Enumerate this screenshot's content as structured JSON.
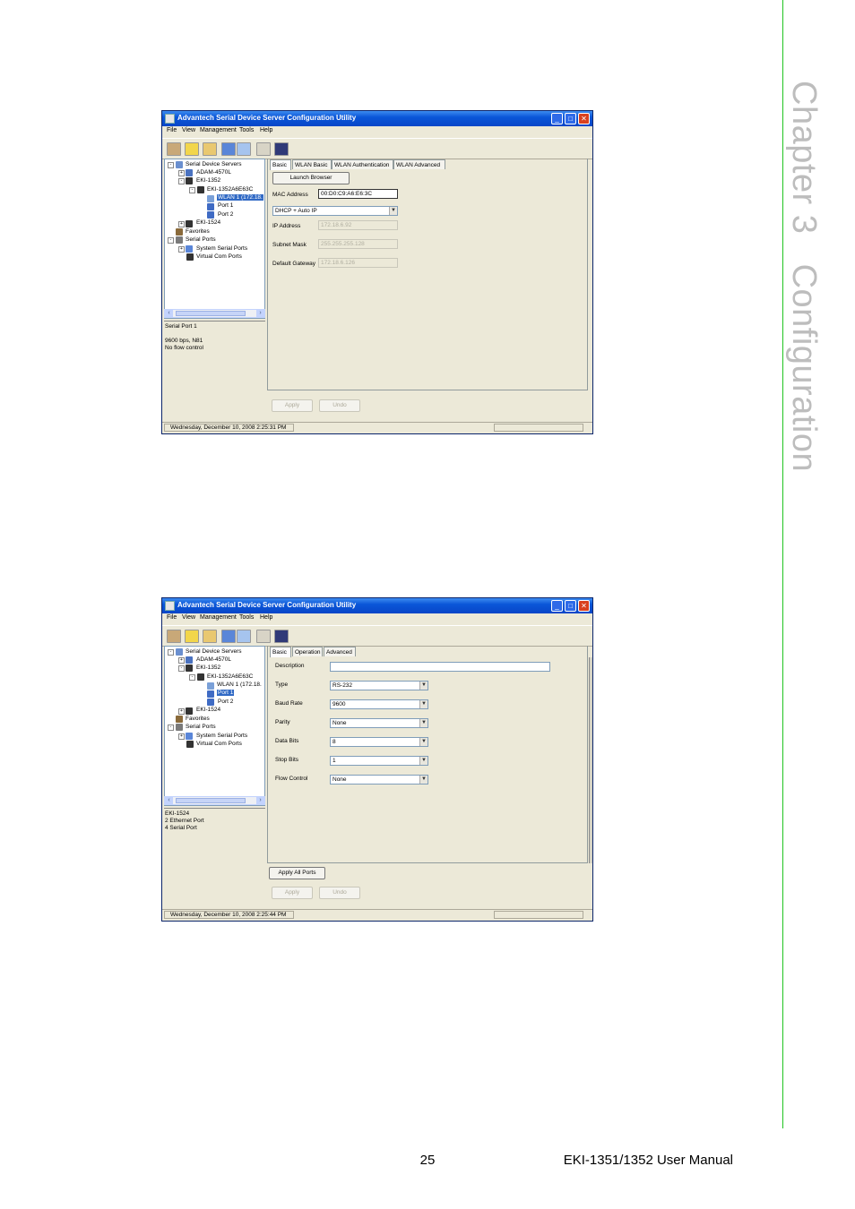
{
  "chapter": {
    "label": "Chapter 3",
    "title": "Configuration"
  },
  "footer": {
    "page_number": "25",
    "manual": "EKI-1351/1352 User Manual"
  },
  "window1": {
    "title": "Advantech Serial Device Server Configuration Utility",
    "menu": [
      "File",
      "View",
      "Management",
      "Tools",
      "Help"
    ],
    "tree": [
      "Serial Device Servers",
      "ADAM-4570L",
      "EKI-1352",
      "EKI-1352A6E63C",
      "WLAN 1 (172.18.",
      "Port 1",
      "Port 2",
      "EKI-1524",
      "Favorites",
      "Serial Ports",
      "System Serial Ports",
      "Virtual Com Ports"
    ],
    "info": [
      "Serial Port 1",
      "",
      "9600 bps, N81",
      "No flow control"
    ],
    "tabs": [
      "Basic",
      "WLAN Basic",
      "WLAN Authentication",
      "WLAN Advanced"
    ],
    "launch_button": "Launch Browser",
    "mac_label": "MAC Address",
    "mac_value": "00:D0:C9:A6:E6:3C",
    "ip_mode": "DHCP + Auto IP",
    "ip_label": "IP Address",
    "ip_value": "172.18.6.92",
    "subnet_label": "Subnet Mask",
    "subnet_value": "255.255.255.128",
    "gateway_label": "Default Gateway",
    "gateway_value": "172.18.6.126",
    "apply": "Apply",
    "undo": "Undo",
    "status": "Wednesday, December 10, 2008  2:25:31 PM"
  },
  "window2": {
    "title": "Advantech Serial Device Server Configuration Utility",
    "menu": [
      "File",
      "View",
      "Management",
      "Tools",
      "Help"
    ],
    "tree": [
      "Serial Device Servers",
      "ADAM-4570L",
      "EKI-1352",
      "EKI-1352A6E63C",
      "WLAN 1 (172.18.",
      "Port 1",
      "Port 2",
      "EKI-1524",
      "Favorites",
      "Serial Ports",
      "System Serial Ports",
      "Virtual Com Ports"
    ],
    "info": [
      "EKI-1524",
      "2 Ethernet Port",
      "4 Serial Port"
    ],
    "tabs": [
      "Basic",
      "Operation",
      "Advanced"
    ],
    "fields": [
      {
        "label": "Description",
        "value": ""
      },
      {
        "label": "Type",
        "value": "RS-232"
      },
      {
        "label": "Baud Rate",
        "value": "9600"
      },
      {
        "label": "Parity",
        "value": "None"
      },
      {
        "label": "Data Bits",
        "value": "8"
      },
      {
        "label": "Stop Bits",
        "value": "1"
      },
      {
        "label": "Flow Control",
        "value": "None"
      }
    ],
    "apply_all": "Apply All Ports",
    "apply": "Apply",
    "undo": "Undo",
    "status": "Wednesday, December 10, 2008  2:25:44 PM"
  }
}
